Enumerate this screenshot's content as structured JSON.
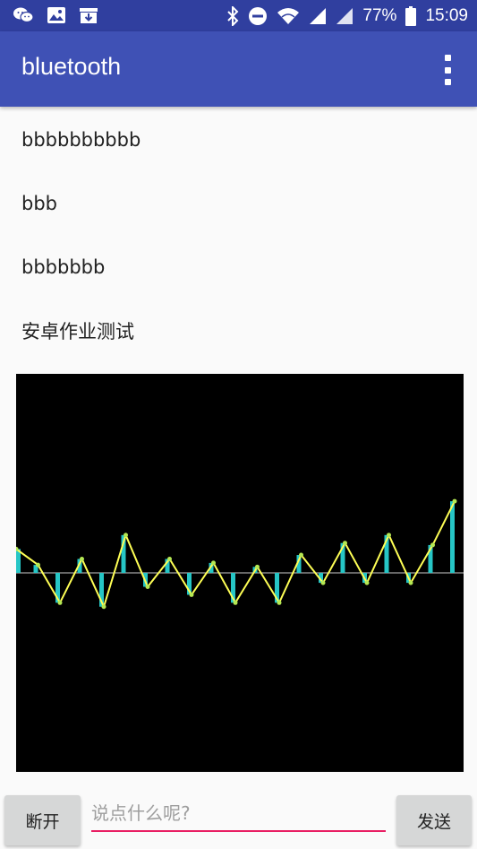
{
  "status_bar": {
    "battery_percent": "77%",
    "time": "15:09",
    "left_icons": [
      "wechat-icon",
      "image-icon",
      "download-icon"
    ],
    "right_icons": [
      "bluetooth-icon",
      "do-not-disturb-icon",
      "wifi-icon",
      "signal-icon",
      "signal-icon",
      "battery-icon"
    ]
  },
  "app_bar": {
    "title": "bluetooth",
    "overflow_icon": "more-vert-icon",
    "color": "#3f51b5",
    "status_color": "#303f9f"
  },
  "messages": [
    {
      "text": "bbbbbbbbbb"
    },
    {
      "text": "bbb"
    },
    {
      "text": "bbbbbbb"
    },
    {
      "text": "安卓作业测试"
    }
  ],
  "chart_data": {
    "type": "bar",
    "background": "#000000",
    "bar_color": "#26c6c6",
    "line_color": "#ffff55",
    "axis_color": "#cccccc",
    "ylim": [
      -100,
      100
    ],
    "values": [
      12,
      4,
      -15,
      7,
      -17,
      19,
      -7,
      7,
      -11,
      5,
      -15,
      3,
      -15,
      9,
      -5,
      15,
      -5,
      19,
      -5,
      14,
      36
    ]
  },
  "bottom_bar": {
    "disconnect_label": "断开",
    "input_placeholder": "说点什么呢?",
    "input_value": "",
    "send_label": "发送",
    "accent": "#e91e63"
  }
}
